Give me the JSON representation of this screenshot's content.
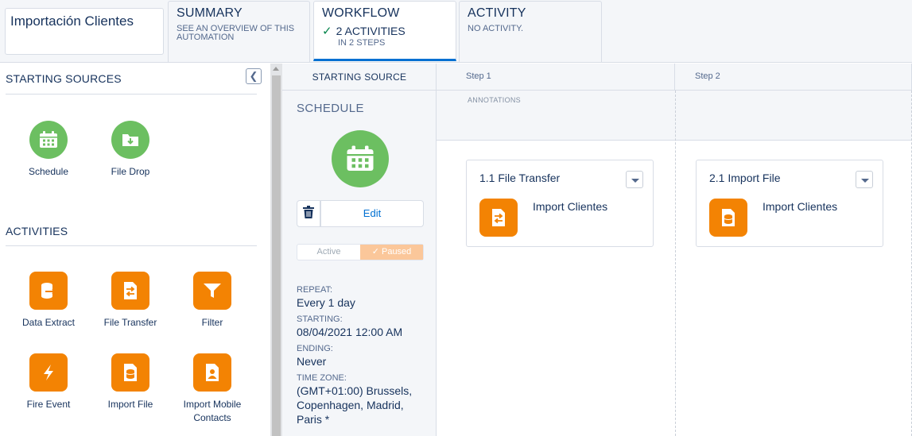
{
  "automation_name": "Importación Clientes",
  "tabs": {
    "summary": {
      "title": "SUMMARY",
      "subtitle": "SEE AN OVERVIEW OF THIS AUTOMATION"
    },
    "workflow": {
      "title": "WORKFLOW",
      "status": "2 ACTIVITIES",
      "subtitle": "IN 2 STEPS",
      "status_icon": "check-icon"
    },
    "activity": {
      "title": "ACTIVITY",
      "subtitle": "NO ACTIVITY."
    }
  },
  "left_panel": {
    "starting_sources_heading": "STARTING SOURCES",
    "starting_sources": [
      {
        "label": "Schedule",
        "icon": "calendar-icon"
      },
      {
        "label": "File Drop",
        "icon": "folder-download-icon"
      }
    ],
    "activities_heading": "ACTIVITIES",
    "activities": [
      {
        "label": "Data Extract",
        "icon": "data-extract-icon"
      },
      {
        "label": "File Transfer",
        "icon": "file-transfer-icon"
      },
      {
        "label": "Filter",
        "icon": "filter-icon"
      },
      {
        "label": "Fire Event",
        "icon": "lightning-icon"
      },
      {
        "label": "Import File",
        "icon": "import-file-icon"
      },
      {
        "label": "Import Mobile Contacts",
        "icon": "contact-card-icon"
      }
    ]
  },
  "canvas": {
    "starting_source_header": "STARTING SOURCE",
    "schedule": {
      "title": "SCHEDULE",
      "edit_label": "Edit",
      "toggle": {
        "active": "Active",
        "paused": "Paused",
        "selected": "paused"
      },
      "repeat_label": "REPEAT:",
      "repeat_value": "Every 1 day",
      "starting_label": "STARTING:",
      "starting_value": "08/04/2021 12:00 AM",
      "ending_label": "ENDING:",
      "ending_value": "Never",
      "timezone_label": "TIME ZONE:",
      "timezone_value": "(GMT+01:00) Brussels, Copenhagen, Madrid, Paris *"
    },
    "annotations_label": "ANNOTATIONS",
    "steps": [
      {
        "header": "Step 1",
        "activity_title": "1.1 File Transfer",
        "activity_name": "Import Clientes",
        "icon": "file-transfer-icon"
      },
      {
        "header": "Step 2",
        "activity_title": "2.1 Import File",
        "activity_name": "Import Clientes",
        "icon": "import-file-icon"
      }
    ]
  },
  "colors": {
    "accent_blue": "#0070d2",
    "schedule_green": "#6cbf61",
    "activity_orange": "#f38303",
    "text_navy": "#16325c"
  }
}
